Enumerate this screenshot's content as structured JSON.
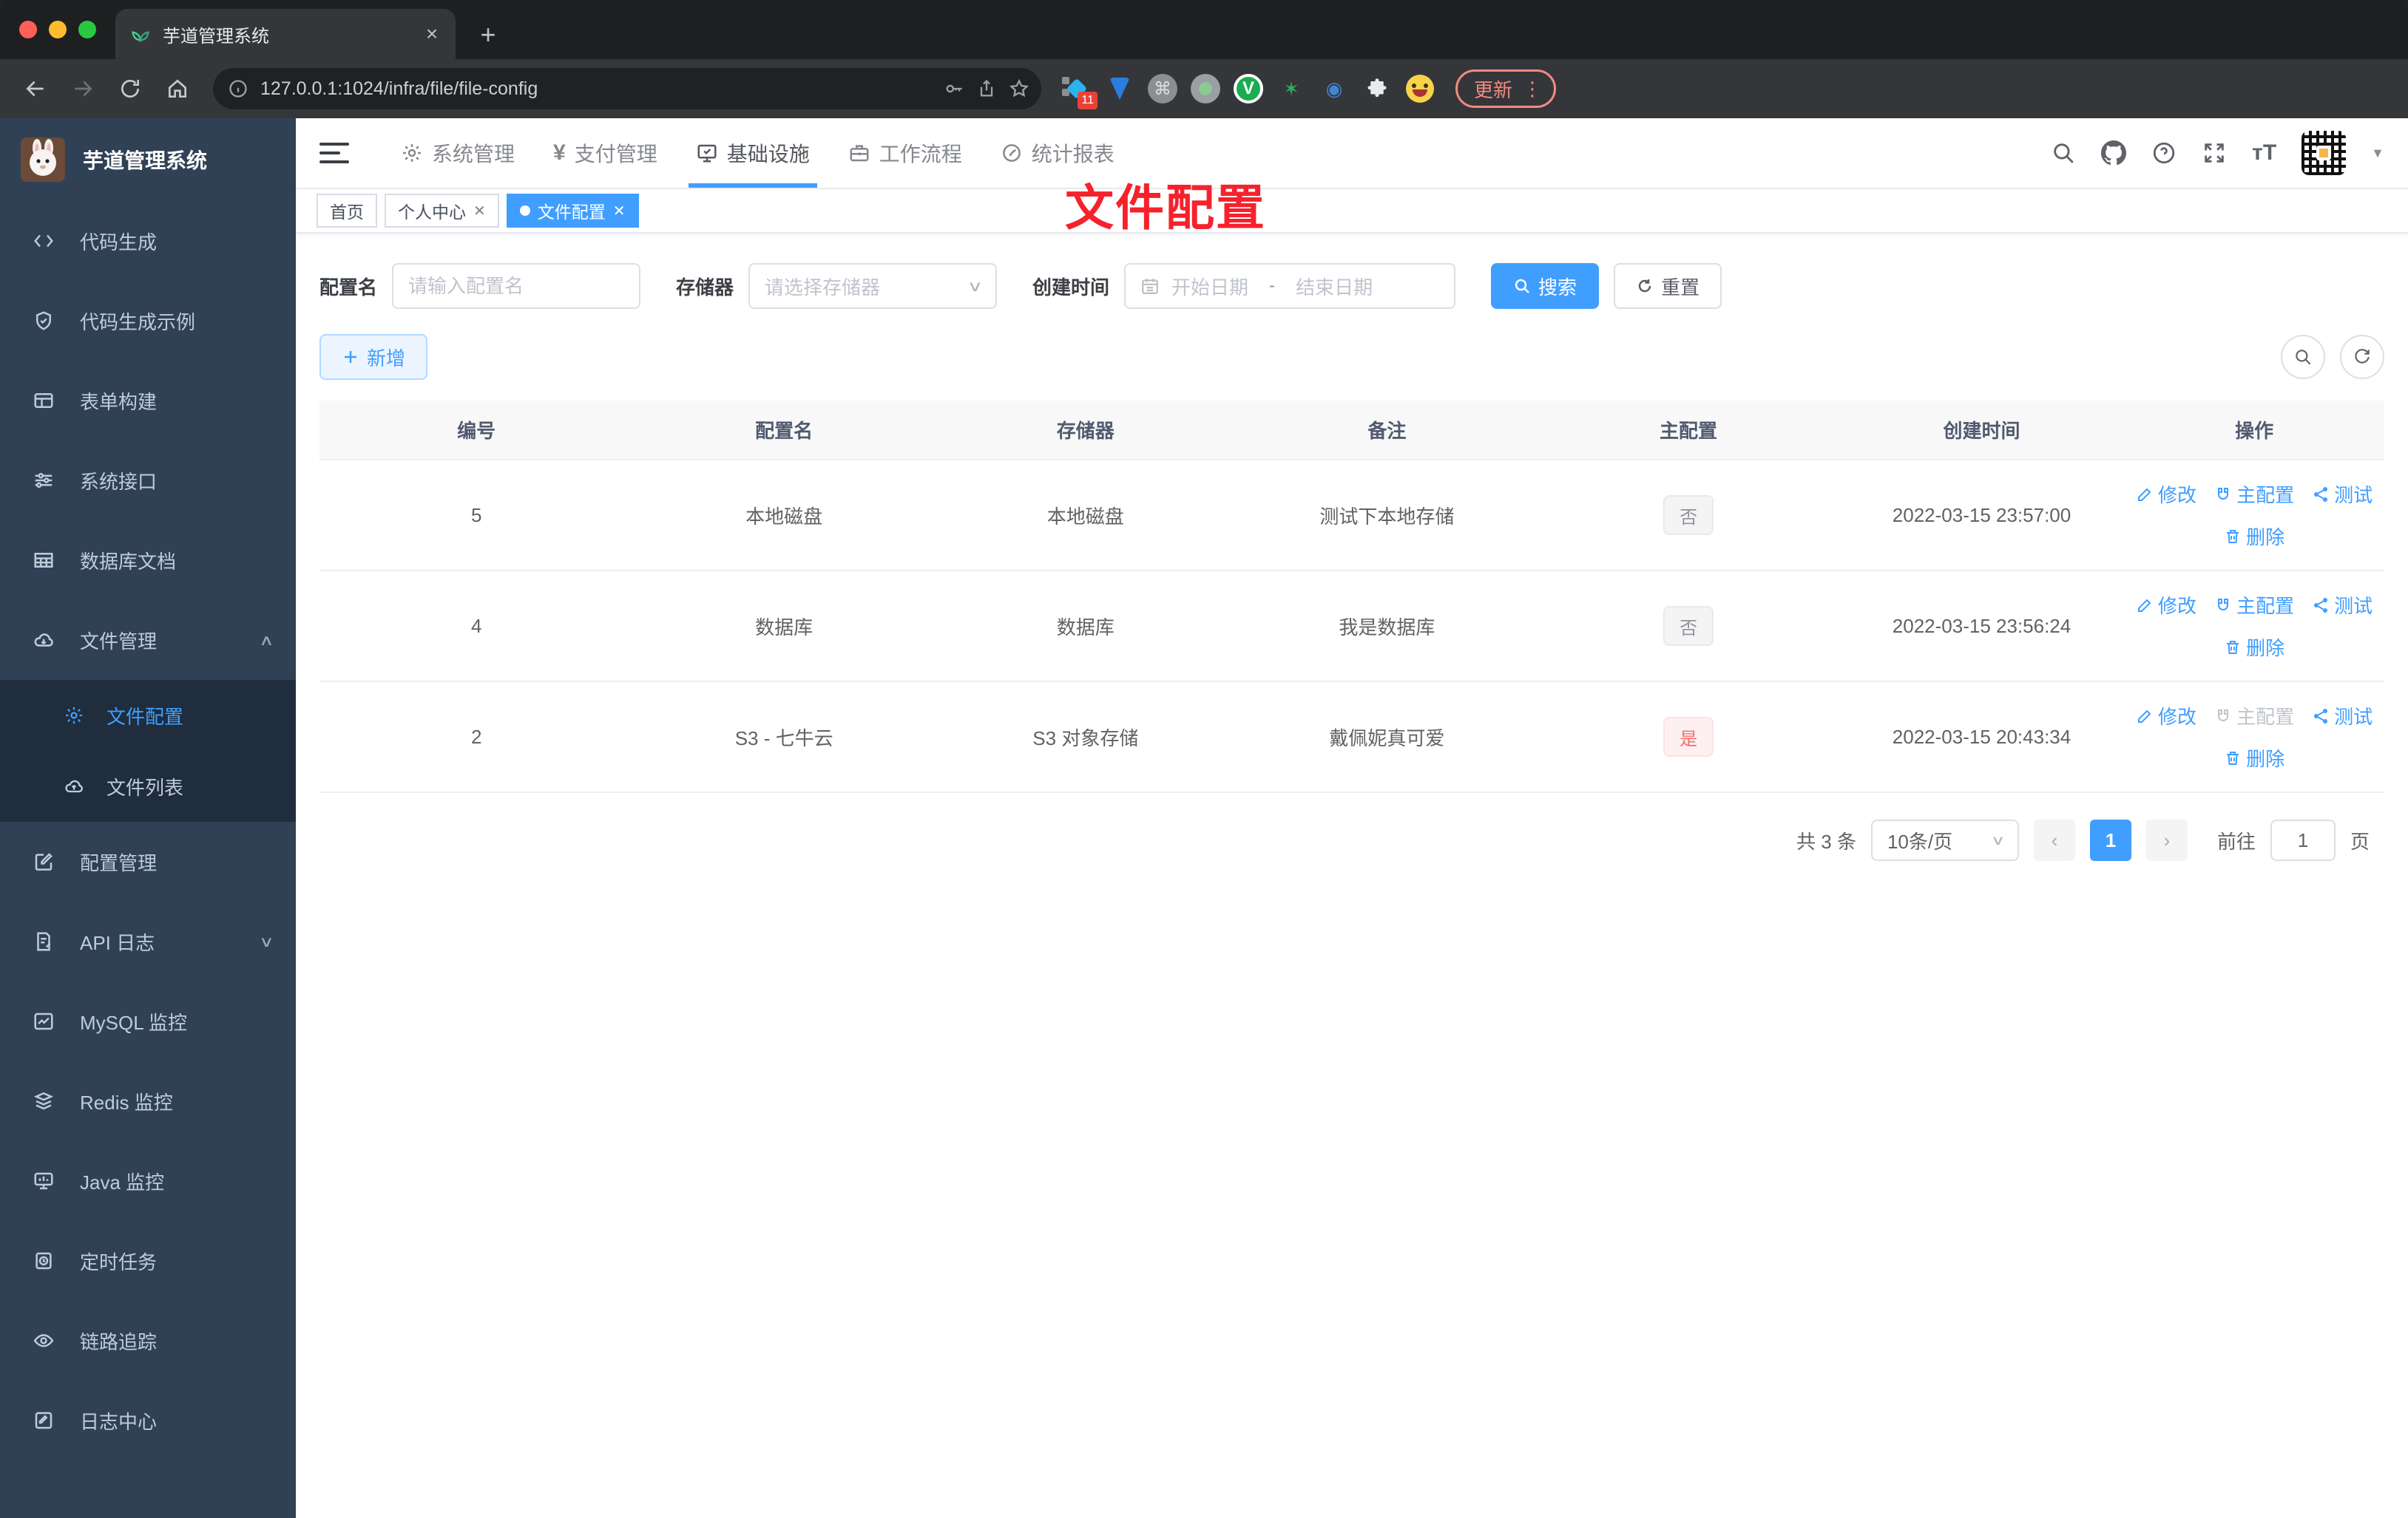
{
  "browser": {
    "tab_title": "芋道管理系统",
    "close_glyph": "×",
    "newtab_glyph": "+",
    "url": "127.0.0.1:1024/infra/file/file-config",
    "extension_badge": "11",
    "cmd_glyph": "⌘",
    "vue_glyph": "V",
    "star_glyph": "✶",
    "eye_glyph": "◉",
    "puzzle_glyph": "⚙",
    "update_label": "更新",
    "menu_dots": "⋮"
  },
  "sidebar": {
    "title": "芋道管理系统",
    "items_top": [
      {
        "label": "代码生成"
      },
      {
        "label": "代码生成示例"
      },
      {
        "label": "表单构建"
      },
      {
        "label": "系统接口"
      },
      {
        "label": "数据库文档"
      }
    ],
    "file_menu": {
      "label": "文件管理",
      "children": [
        {
          "label": "文件配置"
        },
        {
          "label": "文件列表"
        }
      ]
    },
    "items_bottom": [
      {
        "label": "配置管理"
      },
      {
        "label": "API 日志"
      },
      {
        "label": "MySQL 监控"
      },
      {
        "label": "Redis 监控"
      },
      {
        "label": "Java 监控"
      },
      {
        "label": "定时任务"
      },
      {
        "label": "链路追踪"
      },
      {
        "label": "日志中心"
      }
    ]
  },
  "topnav": {
    "items": [
      {
        "label": "系统管理"
      },
      {
        "label": "支付管理"
      },
      {
        "label": "基础设施"
      },
      {
        "label": "工作流程"
      },
      {
        "label": "统计报表"
      }
    ]
  },
  "tags": [
    {
      "label": "首页"
    },
    {
      "label": "个人中心"
    },
    {
      "label": "文件配置"
    }
  ],
  "annotation": {
    "text": "文件配置",
    "color": "#f5222d"
  },
  "filter": {
    "name_label": "配置名",
    "name_placeholder": "请输入配置名",
    "storage_label": "存储器",
    "storage_placeholder": "请选择存储器",
    "date_label": "创建时间",
    "date_start_placeholder": "开始日期",
    "date_separator": "-",
    "date_end_placeholder": "结束日期",
    "search_label": "搜索",
    "reset_label": "重置"
  },
  "toolbar": {
    "add_label": "新增"
  },
  "table": {
    "columns": [
      "编号",
      "配置名",
      "存储器",
      "备注",
      "主配置",
      "创建时间",
      "操作"
    ],
    "actions": {
      "edit": "修改",
      "master": "主配置",
      "test": "测试",
      "delete": "删除"
    },
    "rows": [
      {
        "id": "5",
        "name": "本地磁盘",
        "storage": "本地磁盘",
        "remark": "测试下本地存储",
        "master": "否",
        "created": "2022-03-15 23:57:00"
      },
      {
        "id": "4",
        "name": "数据库",
        "storage": "数据库",
        "remark": "我是数据库",
        "master": "否",
        "created": "2022-03-15 23:56:24"
      },
      {
        "id": "2",
        "name": "S3 - 七牛云",
        "storage": "S3 对象存储",
        "remark": "戴佩妮真可爱",
        "master": "是",
        "created": "2022-03-15 20:43:34"
      }
    ]
  },
  "pagination": {
    "total": "共 3 条",
    "page_size": "10条/页",
    "current_page": "1",
    "goto_label": "前往",
    "goto_value": "1",
    "page_unit": "页"
  },
  "colors": {
    "accent": "#409eff",
    "danger": "#f56c6c",
    "sidebar_bg": "#304156",
    "submenu_bg": "#1f2d3d",
    "annotation_red": "#f5222d"
  }
}
